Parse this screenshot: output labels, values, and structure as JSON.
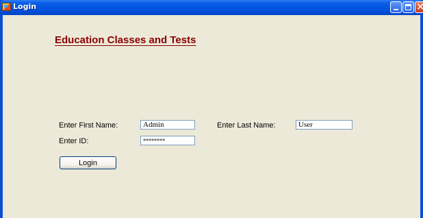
{
  "window": {
    "title": "Login",
    "controls": {
      "minimize_icon": "minimize-icon",
      "maximize_icon": "maximize-icon",
      "close_glyph": "✕"
    },
    "title_color": "#0053e0",
    "client_background": "#ece9d8"
  },
  "form": {
    "heading": "Education Classes and Tests",
    "heading_color": "#8b0000",
    "first_name_label": "Enter First Name:",
    "first_name_value": "Admin",
    "last_name_label": "Enter Last Name:",
    "last_name_value": "User",
    "id_label": "Enter ID:",
    "id_value": "********",
    "login_button": "Login"
  }
}
